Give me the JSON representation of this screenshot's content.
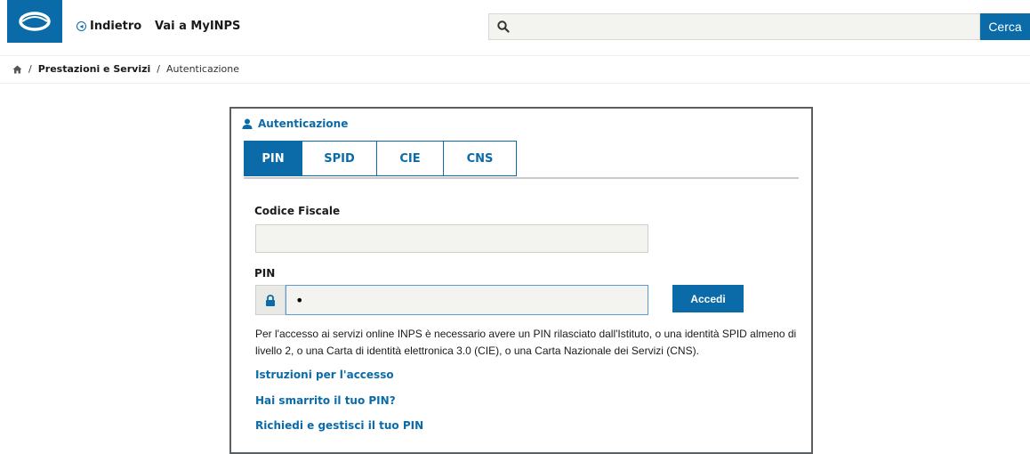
{
  "header": {
    "back_label": "Indietro",
    "myinps_label": "Vai a MyINPS",
    "search_placeholder": "",
    "search_button": "Cerca"
  },
  "breadcrumb": {
    "sep": "/",
    "level1": "Prestazioni e Servizi",
    "level2": "Autenticazione"
  },
  "auth": {
    "title": "Autenticazione",
    "tabs": [
      {
        "label": "PIN",
        "active": true
      },
      {
        "label": "SPID",
        "active": false
      },
      {
        "label": "CIE",
        "active": false
      },
      {
        "label": "CNS",
        "active": false
      }
    ],
    "codice_fiscale_label": "Codice Fiscale",
    "codice_fiscale_value": "",
    "pin_label": "PIN",
    "pin_value": "•",
    "accedi_label": "Accedi",
    "info_text": "Per l'accesso ai servizi online INPS è necessario avere un PIN rilasciato dall'Istituto, o una identità SPID almeno di livello 2, o una Carta di identità elettronica 3.0 (CIE), o una Carta Nazionale dei Servizi (CNS).",
    "links": [
      "Istruzioni per l'accesso",
      "Hai smarrito il tuo PIN?",
      "Richiedi e gestisci il tuo PIN"
    ]
  },
  "colors": {
    "brand": "#0b6ba8",
    "input_bg": "#f3f3ef",
    "card_border": "#5a5f64"
  }
}
